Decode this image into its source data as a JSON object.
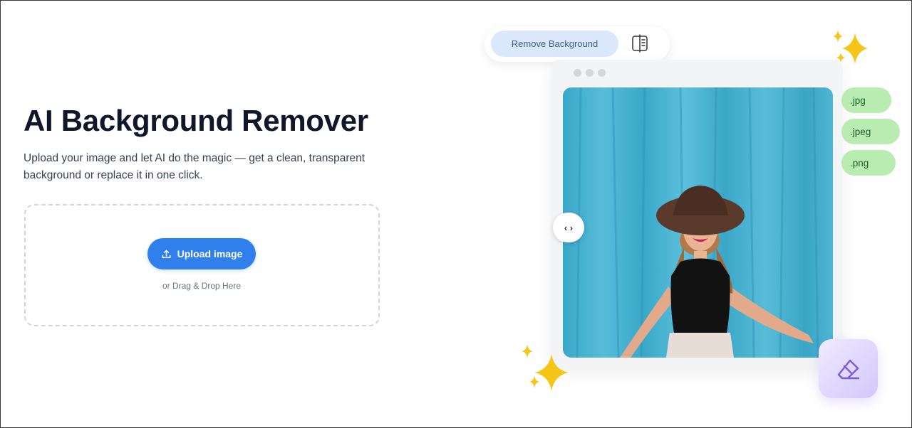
{
  "hero": {
    "title": "AI Background Remover",
    "subtitle": "Upload your image and let AI do the magic — get a clean, transparent background or replace it in one click."
  },
  "upload": {
    "button_label": "Upload image",
    "drag_text": "or Drag & Drop Here"
  },
  "preview": {
    "mode_label": "Remove Background",
    "slider_glyph": "‹ ›",
    "formats": [
      ".jpg",
      ".jpeg",
      ".png"
    ]
  },
  "colors": {
    "primary": "#2f80ed",
    "format_pill": "#b8ecb0",
    "mode_pill": "#dbe8fb",
    "eraser_tile": "#d3c8fb",
    "sparkle": "#f5c518"
  },
  "icons": {
    "upload": "upload-icon",
    "compare": "compare-icon",
    "eraser": "eraser-icon",
    "sparkle": "sparkle-icon"
  }
}
